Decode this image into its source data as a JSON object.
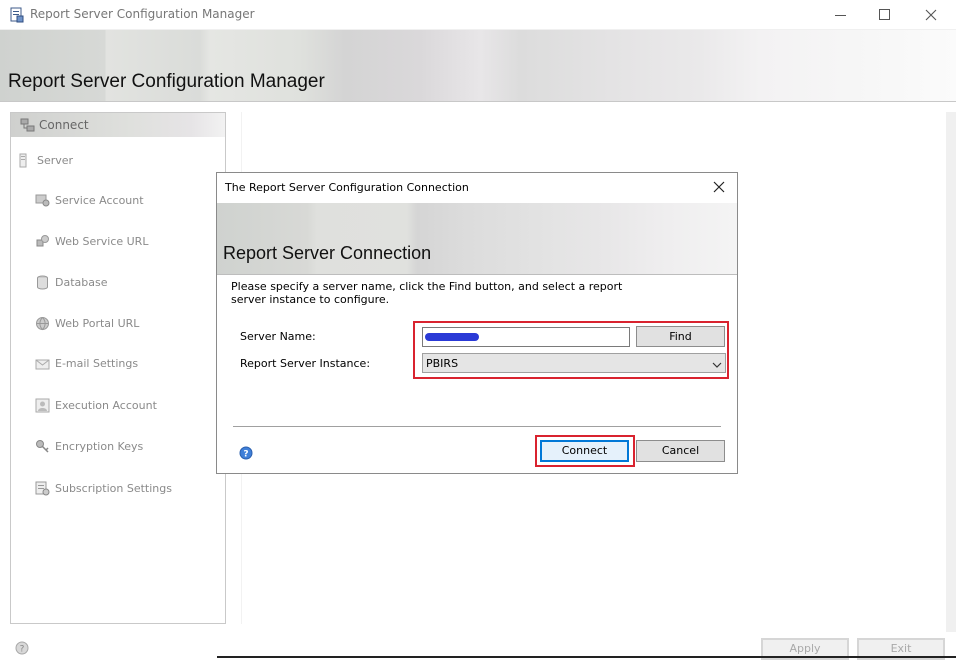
{
  "window": {
    "title": "Report Server Configuration Manager",
    "banner_title": "Report Server Configuration Manager"
  },
  "nav": {
    "connect_label": "Connect",
    "server_label": "Server",
    "items": [
      {
        "label": "Service Account",
        "icon": "service-account-icon"
      },
      {
        "label": "Web Service URL",
        "icon": "web-service-url-icon"
      },
      {
        "label": "Database",
        "icon": "database-icon"
      },
      {
        "label": "Web Portal URL",
        "icon": "web-portal-url-icon"
      },
      {
        "label": "E-mail Settings",
        "icon": "email-settings-icon"
      },
      {
        "label": "Execution Account",
        "icon": "execution-account-icon"
      },
      {
        "label": "Encryption Keys",
        "icon": "encryption-keys-icon"
      },
      {
        "label": "Subscription Settings",
        "icon": "subscription-settings-icon"
      }
    ]
  },
  "footer": {
    "apply_label": "Apply",
    "exit_label": "Exit"
  },
  "dialog": {
    "title": "The Report Server Configuration Connection",
    "banner_title": "Report Server Connection",
    "instructions": "Please specify a server name, click the Find button, and select a report server instance to configure.",
    "server_name_label": "Server Name:",
    "server_name_value": "",
    "find_label": "Find",
    "instance_label": "Report Server Instance:",
    "instance_value": "PBIRS",
    "connect_label": "Connect",
    "cancel_label": "Cancel"
  },
  "colors": {
    "highlight": "#d9232f",
    "focus": "#0078d7",
    "redaction": "#2a3ad6"
  }
}
